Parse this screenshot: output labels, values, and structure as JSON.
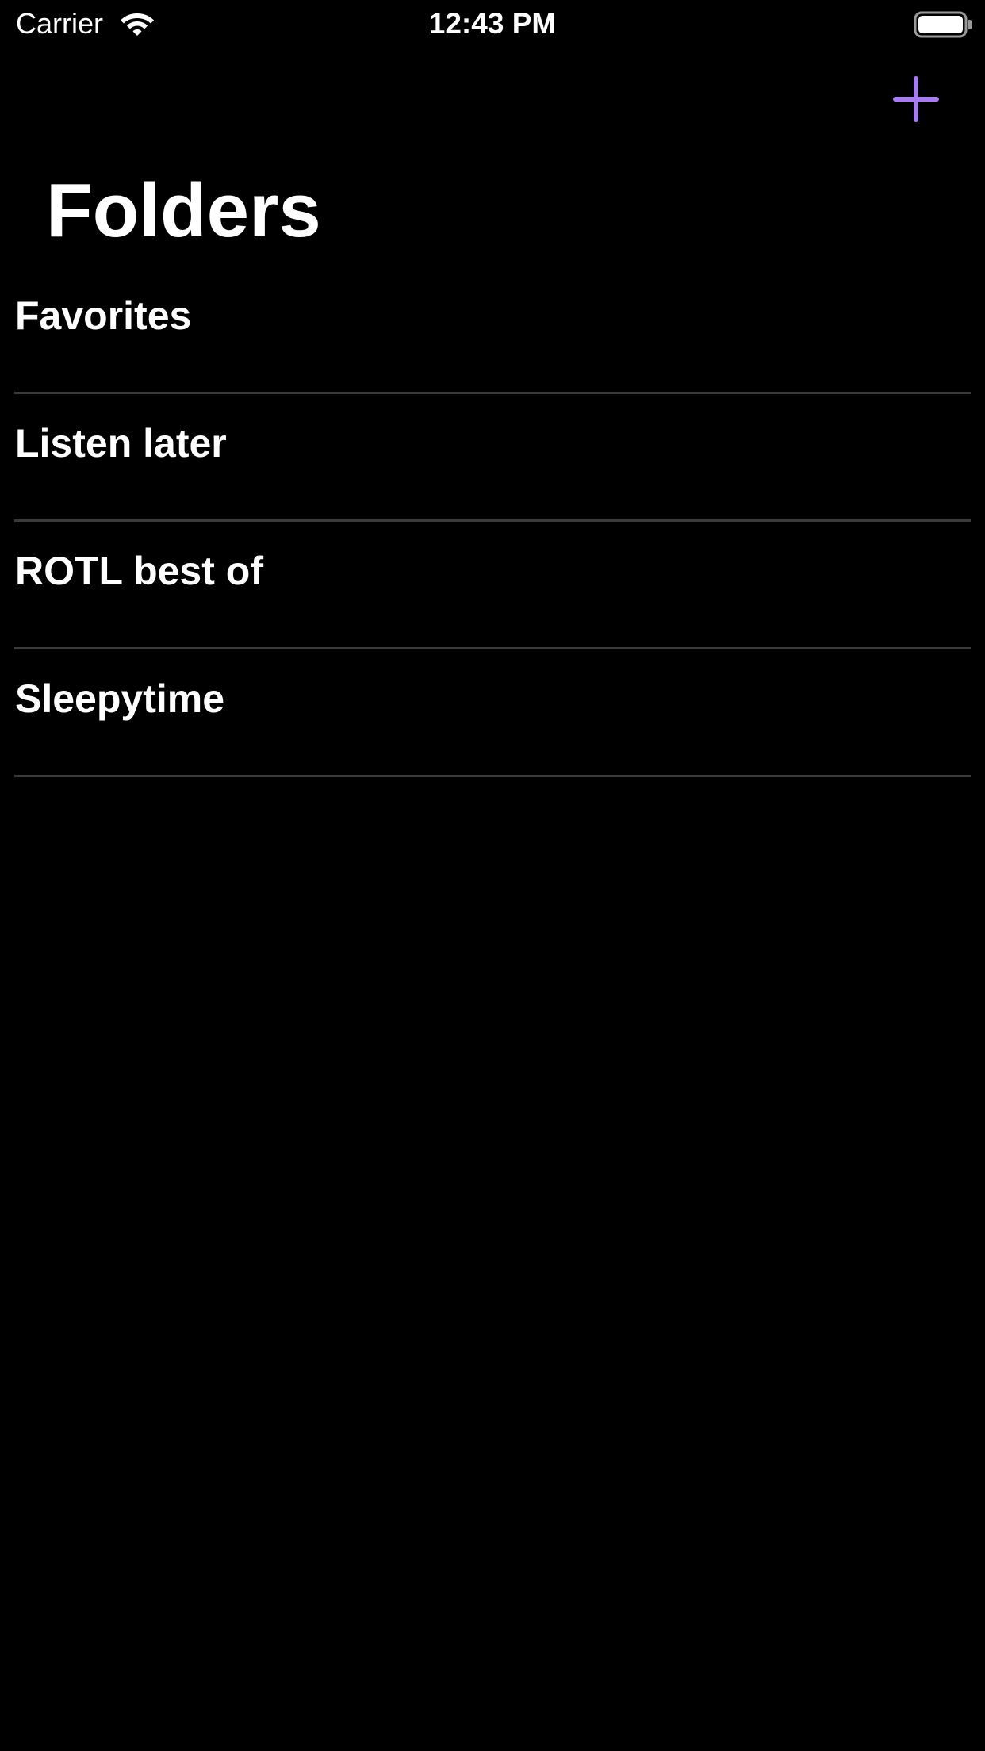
{
  "status_bar": {
    "carrier": "Carrier",
    "time": "12:43 PM",
    "wifi_icon": "wifi-icon",
    "battery_icon": "battery-full-icon"
  },
  "nav": {
    "add_icon": "plus-icon",
    "accent_color": "#a77bf3"
  },
  "page": {
    "title": "Folders"
  },
  "folders": [
    {
      "label": "Favorites"
    },
    {
      "label": "Listen later"
    },
    {
      "label": "ROTL best of"
    },
    {
      "label": "Sleepytime"
    }
  ],
  "colors": {
    "background": "#000000",
    "text": "#ffffff",
    "divider": "#3a3a3c"
  }
}
